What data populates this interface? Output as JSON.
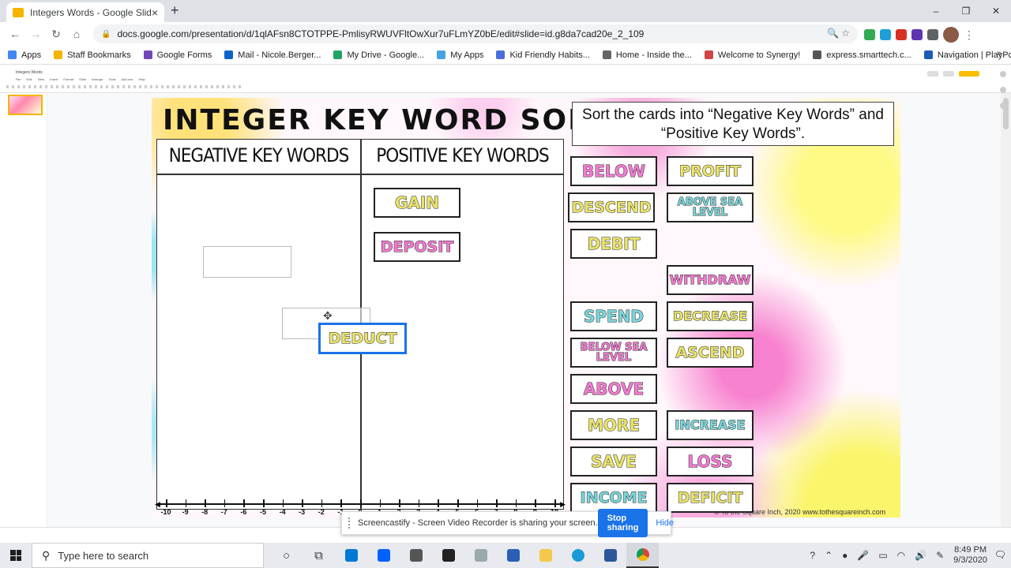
{
  "browser": {
    "tab_title": "Integers Words - Google Slides",
    "new_tab": "+",
    "close_tab": "×",
    "url": "docs.google.com/presentation/d/1qlAFsn8CTOTPPE-PmlisyRWUVFltOwXur7uFLmYZ0bE/edit#slide=id.g8da7cad20e_2_109",
    "window_controls": [
      "–",
      "❐",
      "✕"
    ],
    "bookmarks": [
      {
        "label": "Apps",
        "color": "#4285f4"
      },
      {
        "label": "Staff Bookmarks",
        "color": "#f4b400"
      },
      {
        "label": "Google Forms",
        "color": "#7248b9"
      },
      {
        "label": "Mail - Nicole.Berger...",
        "color": "#0a64c8"
      },
      {
        "label": "My Drive - Google...",
        "color": "#1fa463"
      },
      {
        "label": "My Apps",
        "color": "#46a3e0"
      },
      {
        "label": "Kid Friendly Habits...",
        "color": "#4a6fd8"
      },
      {
        "label": "Home - Inside the...",
        "color": "#666666"
      },
      {
        "label": "Welcome to Synergy!",
        "color": "#d04545"
      },
      {
        "label": "express.smarttech.c...",
        "color": "#555555"
      },
      {
        "label": "Navigation | PlayPo...",
        "color": "#1a5fb4"
      }
    ],
    "bookmarks_more": "»"
  },
  "slides_app": {
    "doc_title": "Integers Words",
    "menu": "File Edit View Insert Format Slide Arrange Tools Add-ons Help"
  },
  "slide": {
    "title": "INTEGER KEY WORD SORT",
    "instructions": "Sort the cards into “Negative Key Words” and “Positive Key Words”.",
    "negative_header": "NEGATIVE KEY WORDS",
    "positive_header": "POSITIVE KEY WORDS",
    "copyright": "© To the Square Inch, 2020 www.tothesquareinch.com",
    "number_line": [
      "-10",
      "-9",
      "-8",
      "-7",
      "-6",
      "-5",
      "-4",
      "-3",
      "-2",
      "-1",
      "0",
      "1",
      "2",
      "3",
      "4",
      "5",
      "6",
      "7",
      "8",
      "9",
      "10"
    ]
  },
  "cards": [
    {
      "label": "GAIN",
      "color": "yellow"
    },
    {
      "label": "DEPOSIT",
      "color": "pink"
    },
    {
      "label": "DEDUCT",
      "color": "yellow"
    },
    {
      "label": "BELOW",
      "color": "pink"
    },
    {
      "label": "PROFIT",
      "color": "yellow"
    },
    {
      "label": "DESCEND",
      "color": "yellow"
    },
    {
      "label": "ABOVE SEA LEVEL",
      "color": "teal"
    },
    {
      "label": "DEBIT",
      "color": "yellow"
    },
    {
      "label": "WITHDRAW",
      "color": "pink"
    },
    {
      "label": "SPEND",
      "color": "teal"
    },
    {
      "label": "DECREASE",
      "color": "yellow"
    },
    {
      "label": "BELOW SEA LEVEL",
      "color": "pink"
    },
    {
      "label": "ASCEND",
      "color": "yellow"
    },
    {
      "label": "ABOVE",
      "color": "pink"
    },
    {
      "label": "MORE",
      "color": "yellow"
    },
    {
      "label": "INCREASE",
      "color": "teal"
    },
    {
      "label": "SAVE",
      "color": "yellow"
    },
    {
      "label": "LOSS",
      "color": "pink"
    },
    {
      "label": "INCOME",
      "color": "teal"
    },
    {
      "label": "DEFICIT",
      "color": "yellow"
    }
  ],
  "screencastify": {
    "message": "Screencastify - Screen Video Recorder is sharing your screen.",
    "stop": "Stop sharing",
    "hide": "Hide"
  },
  "taskbar": {
    "search_placeholder": "Type here to search",
    "time": "8:49 PM",
    "date": "9/3/2020"
  },
  "colors": {
    "pink": "#f27bd0",
    "yellow": "#e9e26a",
    "teal": "#7ad6da",
    "accent": "#1a73e8"
  }
}
